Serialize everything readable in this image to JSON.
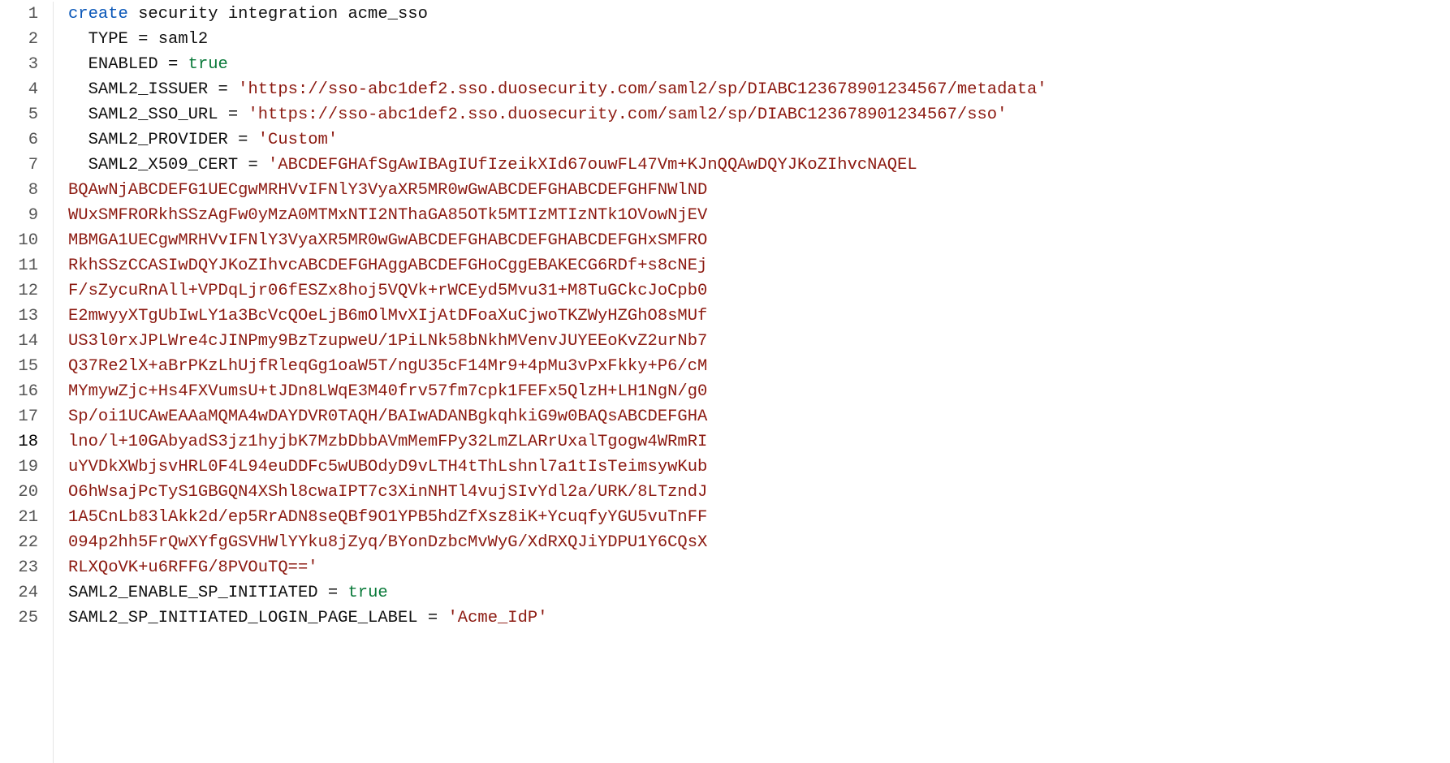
{
  "code": {
    "lines": [
      {
        "n": 1,
        "indent": 0,
        "segments": [
          {
            "cls": "tok-kw",
            "text": "create"
          },
          {
            "cls": "",
            "text": " security integration acme_sso"
          }
        ]
      },
      {
        "n": 2,
        "indent": 1,
        "segments": [
          {
            "cls": "",
            "text": "TYPE = saml2"
          }
        ]
      },
      {
        "n": 3,
        "indent": 1,
        "segments": [
          {
            "cls": "",
            "text": "ENABLED = "
          },
          {
            "cls": "tok-bool",
            "text": "true"
          }
        ]
      },
      {
        "n": 4,
        "indent": 1,
        "segments": [
          {
            "cls": "",
            "text": "SAML2_ISSUER = "
          },
          {
            "cls": "tok-str",
            "text": "'https://sso-abc1def2.sso.duosecurity.com/saml2/sp/DIABC123678901234567/metadata'"
          }
        ]
      },
      {
        "n": 5,
        "indent": 1,
        "segments": [
          {
            "cls": "",
            "text": "SAML2_SSO_URL = "
          },
          {
            "cls": "tok-str",
            "text": "'https://sso-abc1def2.sso.duosecurity.com/saml2/sp/DIABC123678901234567/sso'"
          }
        ]
      },
      {
        "n": 6,
        "indent": 1,
        "segments": [
          {
            "cls": "",
            "text": "SAML2_PROVIDER = "
          },
          {
            "cls": "tok-str",
            "text": "'Custom'"
          }
        ]
      },
      {
        "n": 7,
        "indent": 1,
        "segments": [
          {
            "cls": "",
            "text": "SAML2_X509_CERT = "
          },
          {
            "cls": "tok-str",
            "text": "'ABCDEFGHAfSgAwIBAgIUfIzeikXId67ouwFL47Vm+KJnQQAwDQYJKoZIhvcNAQEL"
          }
        ]
      },
      {
        "n": 8,
        "indent": 0,
        "segments": [
          {
            "cls": "tok-str",
            "text": "BQAwNjABCDEFG1UECgwMRHVvIFNlY3VyaXR5MR0wGwABCDEFGHABCDEFGHFNWlND"
          }
        ]
      },
      {
        "n": 9,
        "indent": 0,
        "segments": [
          {
            "cls": "tok-str",
            "text": "WUxSMFRORkhSSzAgFw0yMzA0MTMxNTI2NThaGA85OTk5MTIzMTIzNTk1OVowNjEV"
          }
        ]
      },
      {
        "n": 10,
        "indent": 0,
        "segments": [
          {
            "cls": "tok-str",
            "text": "MBMGA1UECgwMRHVvIFNlY3VyaXR5MR0wGwABCDEFGHABCDEFGHABCDEFGHxSMFRO"
          }
        ]
      },
      {
        "n": 11,
        "indent": 0,
        "segments": [
          {
            "cls": "tok-str",
            "text": "RkhSSzCCASIwDQYJKoZIhvcABCDEFGHAggABCDEFGHoCggEBAKECG6RDf+s8cNEj"
          }
        ]
      },
      {
        "n": 12,
        "indent": 0,
        "segments": [
          {
            "cls": "tok-str",
            "text": "F/sZycuRnAll+VPDqLjr06fESZx8hoj5VQVk+rWCEyd5Mvu31+M8TuGCkcJoCpb0"
          }
        ]
      },
      {
        "n": 13,
        "indent": 0,
        "segments": [
          {
            "cls": "tok-str",
            "text": "E2mwyyXTgUbIwLY1a3BcVcQOeLjB6mOlMvXIjAtDFoaXuCjwoTKZWyHZGhO8sMUf"
          }
        ]
      },
      {
        "n": 14,
        "indent": 0,
        "segments": [
          {
            "cls": "tok-str",
            "text": "US3l0rxJPLWre4cJINPmy9BzTzupweU/1PiLNk58bNkhMVenvJUYEEoKvZ2urNb7"
          }
        ]
      },
      {
        "n": 15,
        "indent": 0,
        "segments": [
          {
            "cls": "tok-str",
            "text": "Q37Re2lX+aBrPKzLhUjfRleqGg1oaW5T/ngU35cF14Mr9+4pMu3vPxFkky+P6/cM"
          }
        ]
      },
      {
        "n": 16,
        "indent": 0,
        "segments": [
          {
            "cls": "tok-str",
            "text": "MYmywZjc+Hs4FXVumsU+tJDn8LWqE3M40frv57fm7cpk1FEFx5QlzH+LH1NgN/g0"
          }
        ]
      },
      {
        "n": 17,
        "indent": 0,
        "segments": [
          {
            "cls": "tok-str",
            "text": "Sp/oi1UCAwEAAaMQMA4wDAYDVR0TAQH/BAIwADANBgkqhkiG9w0BAQsABCDEFGHA"
          }
        ]
      },
      {
        "n": 18,
        "indent": 0,
        "segments": [
          {
            "cls": "tok-str",
            "text": "lno/l+10GAbyadS3jz1hyjbK7MzbDbbAVmMemFPy32LmZLARrUxalTgogw4WRmRI"
          }
        ]
      },
      {
        "n": 19,
        "indent": 0,
        "segments": [
          {
            "cls": "tok-str",
            "text": "uYVDkXWbjsvHRL0F4L94euDDFc5wUBOdyD9vLTH4tThLshnl7a1tIsTeimsywKub"
          }
        ]
      },
      {
        "n": 20,
        "indent": 0,
        "segments": [
          {
            "cls": "tok-str",
            "text": "O6hWsajPcTyS1GBGQN4XShl8cwaIPT7c3XinNHTl4vujSIvYdl2a/URK/8LTzndJ"
          }
        ]
      },
      {
        "n": 21,
        "indent": 0,
        "segments": [
          {
            "cls": "tok-str",
            "text": "1A5CnLb83lAkk2d/ep5RrADN8seQBf9O1YPB5hdZfXsz8iK+YcuqfyYGU5vuTnFF"
          }
        ]
      },
      {
        "n": 22,
        "indent": 0,
        "segments": [
          {
            "cls": "tok-str",
            "text": "094p2hh5FrQwXYfgGSVHWlYYku8jZyq/BYonDzbcMvWyG/XdRXQJiYDPU1Y6CQsX"
          }
        ]
      },
      {
        "n": 23,
        "indent": 0,
        "segments": [
          {
            "cls": "tok-str",
            "text": "RLXQoVK+u6RFFG/8PVOuTQ=='"
          }
        ]
      },
      {
        "n": 24,
        "indent": 0,
        "segments": [
          {
            "cls": "",
            "text": "SAML2_ENABLE_SP_INITIATED = "
          },
          {
            "cls": "tok-bool",
            "text": "true"
          }
        ]
      },
      {
        "n": 25,
        "indent": 0,
        "segments": [
          {
            "cls": "",
            "text": "SAML2_SP_INITIATED_LOGIN_PAGE_LABEL = "
          },
          {
            "cls": "tok-str",
            "text": "'Acme_IdP'"
          }
        ]
      }
    ],
    "active_line": 18,
    "indent_unit": "  "
  }
}
